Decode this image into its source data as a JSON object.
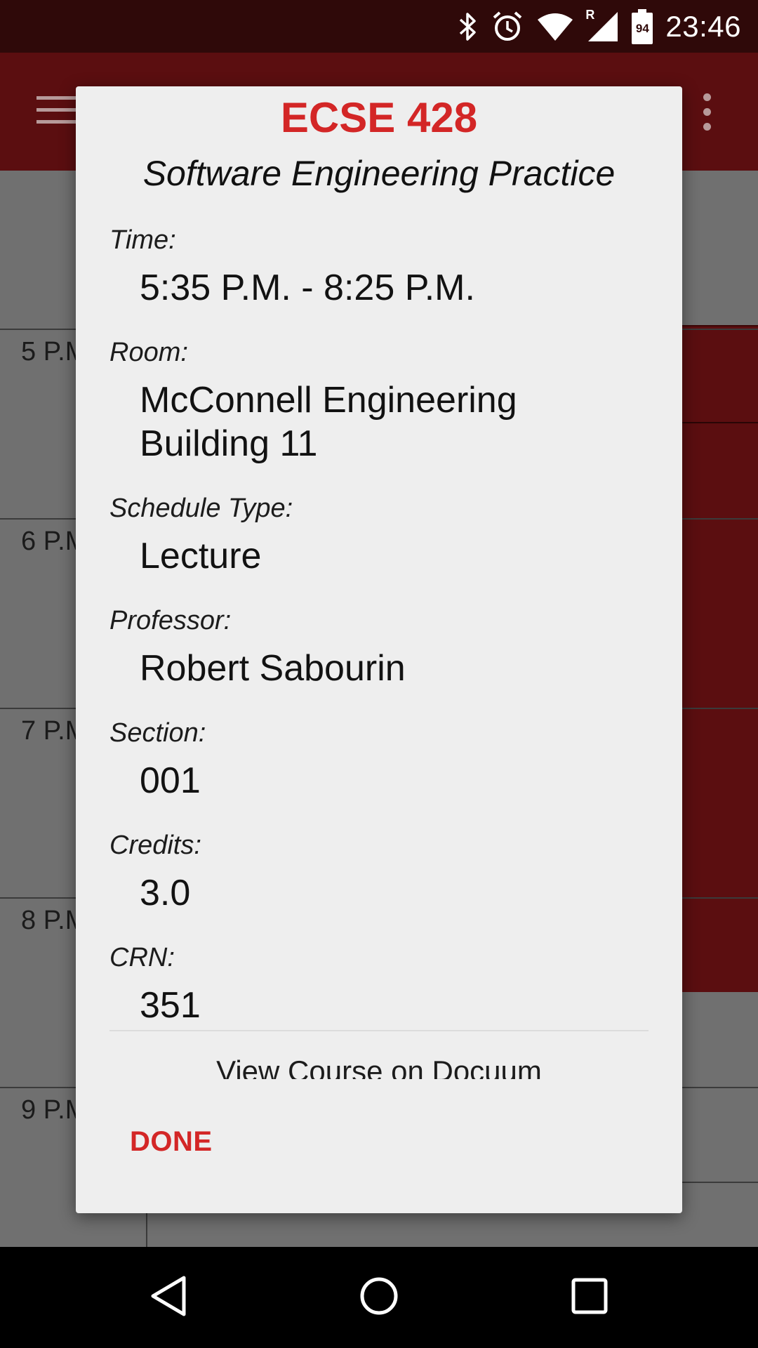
{
  "status_bar": {
    "time": "23:46",
    "battery_level": "94",
    "network_label": "R",
    "icons": [
      "bluetooth-icon",
      "alarm-icon",
      "wifi-icon",
      "cell-signal-icon",
      "battery-icon"
    ]
  },
  "schedule": {
    "hours": [
      "5 P.M",
      "6 P.M",
      "7 P.M",
      "8 P.M",
      "9 P.M"
    ]
  },
  "dialog": {
    "course_code": "ECSE 428",
    "course_name": "Software Engineering Practice",
    "fields": {
      "time": {
        "label": "Time:",
        "value": "5:35 P.M. - 8:25 P.M."
      },
      "room": {
        "label": "Room:",
        "value_line1": "McConnell Engineering",
        "value_line2": "Building 11"
      },
      "schedule_type": {
        "label": "Schedule Type:",
        "value": "Lecture"
      },
      "professor": {
        "label": "Professor:",
        "value": "Robert Sabourin"
      },
      "section": {
        "label": "Section:",
        "value": "001"
      },
      "credits": {
        "label": "Credits:",
        "value": "3.0"
      },
      "crn": {
        "label": "CRN:",
        "value": "351"
      }
    },
    "link_label": "View Course on Docuum",
    "done_label": "DONE"
  },
  "colors": {
    "accent": "#d32626",
    "status_bar": "#2f0909",
    "app_bar_dimmed": "#5b0e10",
    "dialog_bg": "#eeeeee"
  }
}
